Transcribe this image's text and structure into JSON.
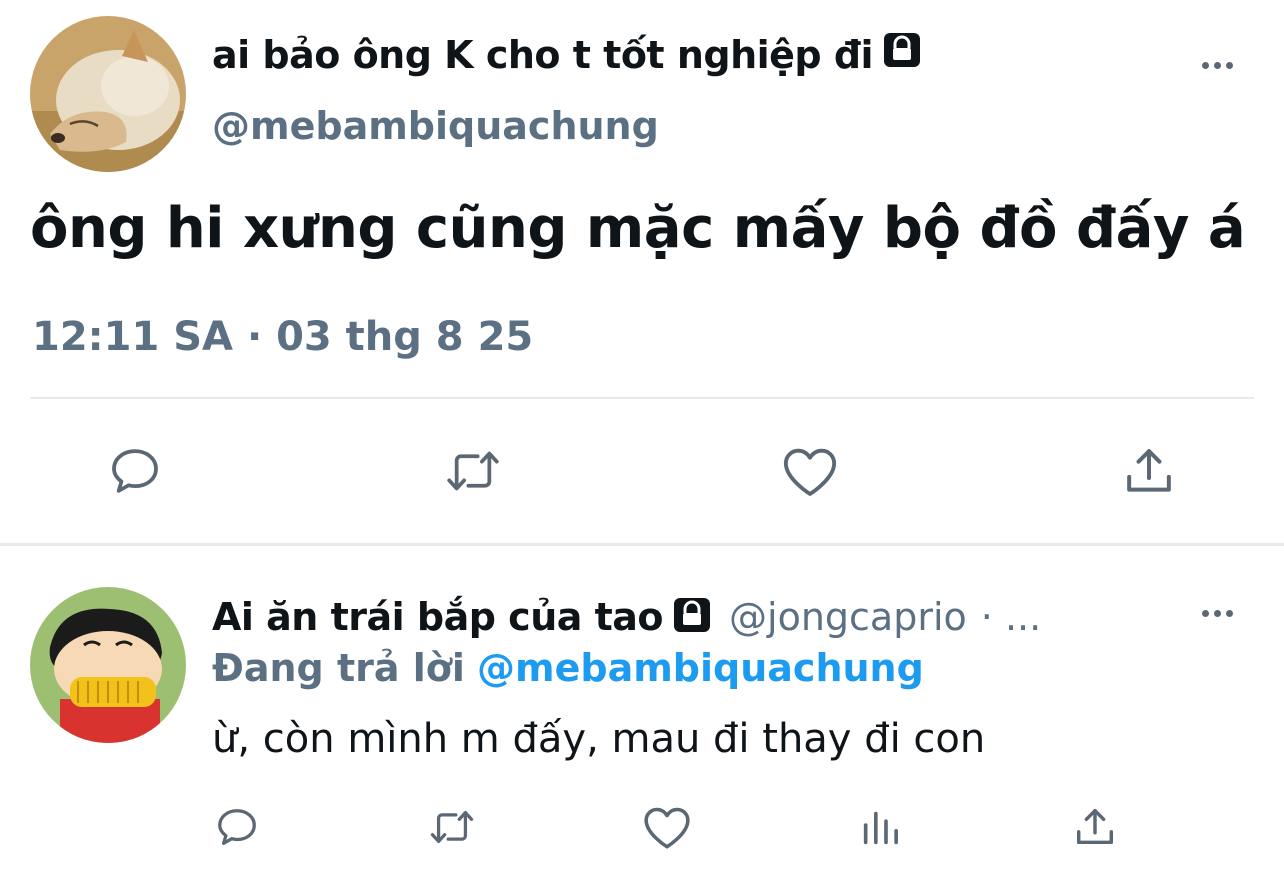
{
  "main_tweet": {
    "author_name": "ai bảo ông K cho t tốt nghiệp đi",
    "protected_icon": "lock-icon",
    "handle": "@mebambiquachung",
    "text": "ông hi xưng cũng mặc mấy bộ đồ đấy á",
    "timestamp": "12:11 SA · 03 thg 8 25",
    "actions": [
      "reply-icon",
      "retweet-icon",
      "like-icon",
      "share-icon"
    ]
  },
  "reply_tweet": {
    "author_name": "Ai ăn trái bắp của tao",
    "protected_icon": "lock-icon",
    "handle": "@jongcaprio",
    "separator": "· ...",
    "replying_prefix": "Đang trả lời",
    "replying_to": "@mebambiquachung",
    "text": "ừ, còn mình m đấy, mau đi thay đi con",
    "actions": [
      "reply-icon",
      "retweet-icon",
      "like-icon",
      "analytics-icon",
      "share-icon"
    ]
  },
  "colors": {
    "text": "#0f1419",
    "secondary": "#5b7083",
    "link": "#1d9bf0",
    "icon": "#5b6773",
    "divider": "#e7eaed"
  }
}
